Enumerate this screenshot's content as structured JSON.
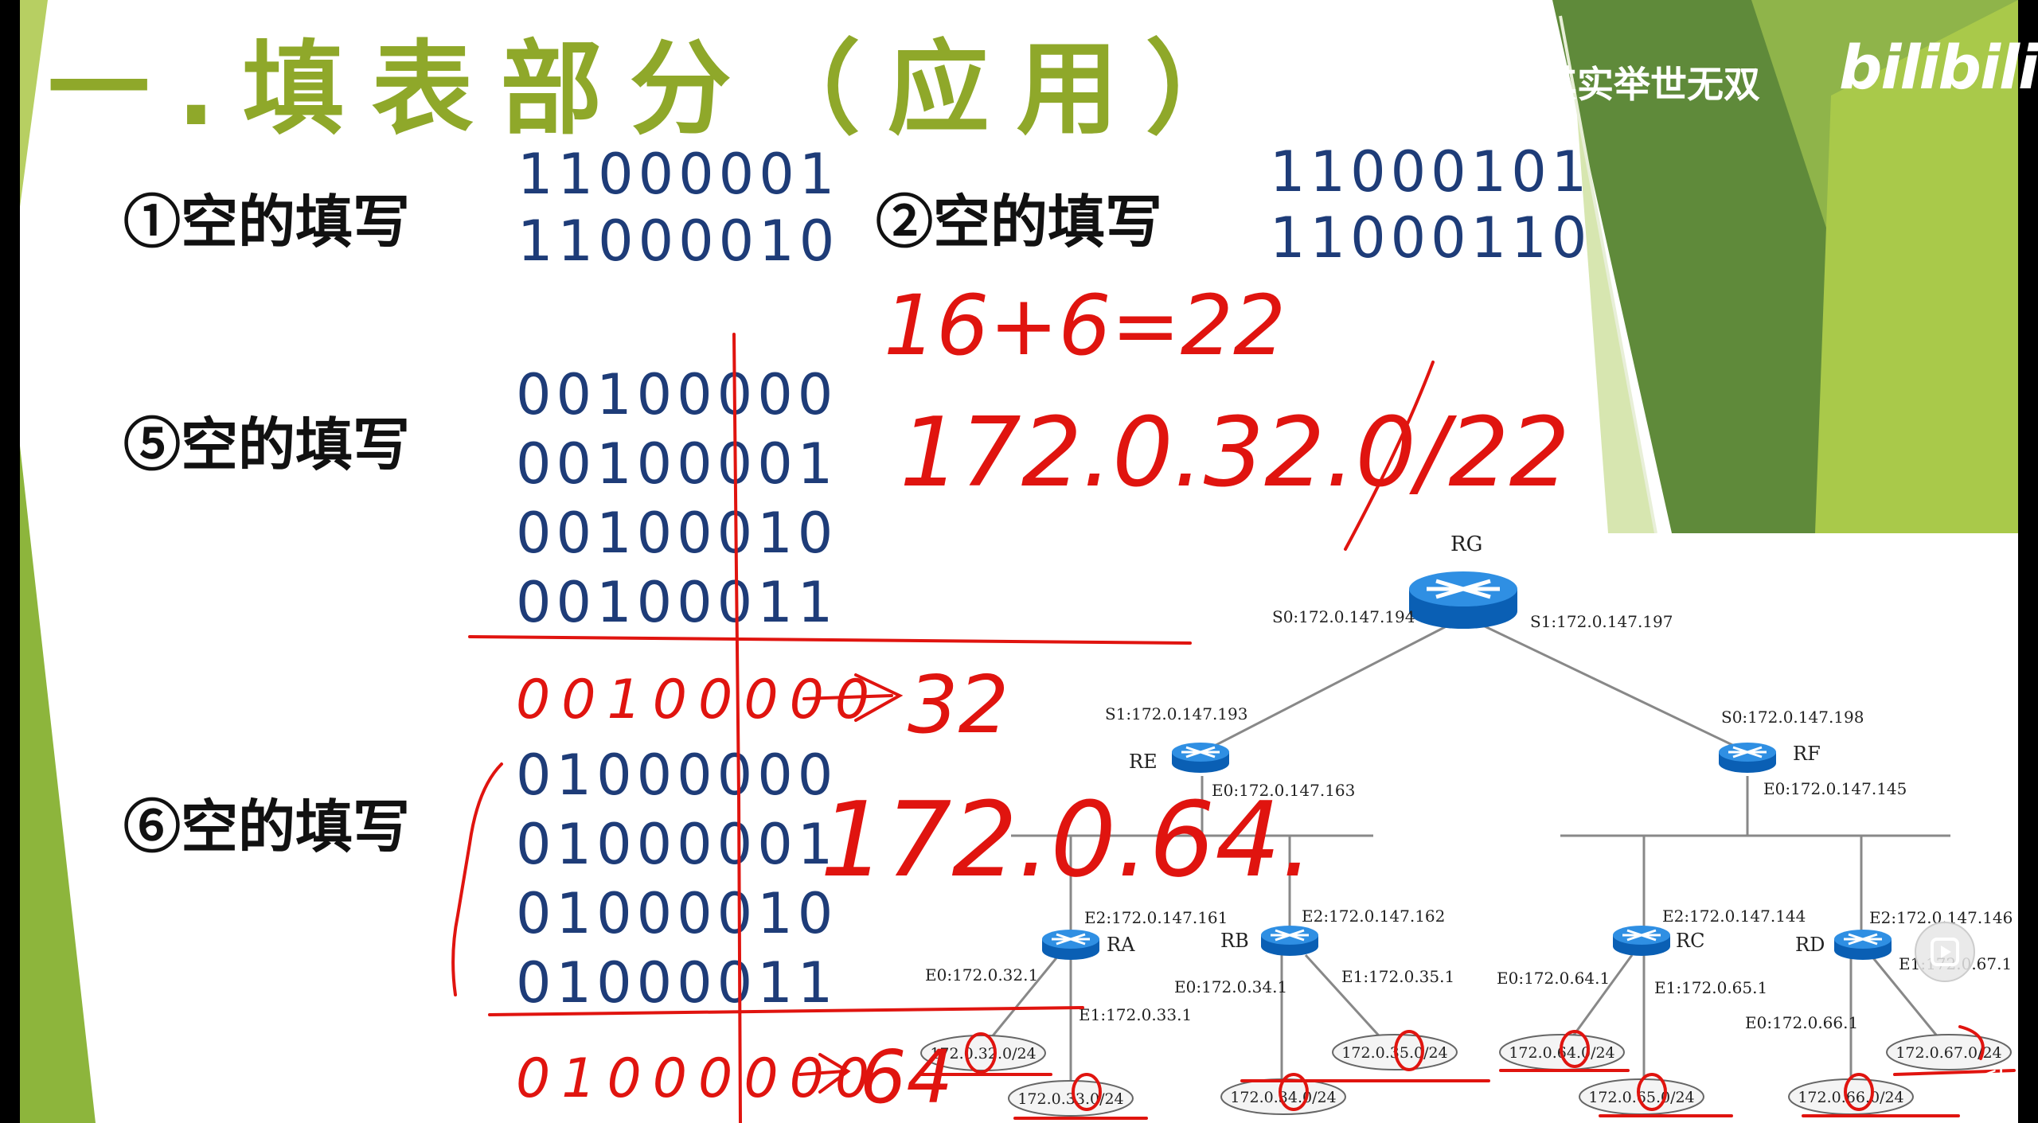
{
  "slide": {
    "title": "一.填表部分（应用）",
    "blank1": {
      "label": "①空的填写",
      "lines": [
        "11000001",
        "11000010"
      ]
    },
    "blank2": {
      "label": "②空的填写",
      "lines": [
        "11000101",
        "11000110"
      ]
    },
    "blank5": {
      "label": "⑤空的填写",
      "lines": [
        "00100000",
        "00100001",
        "00100010",
        "00100011"
      ]
    },
    "blank6": {
      "label": "⑥空的填写",
      "lines": [
        "01000000",
        "01000001",
        "01000010",
        "01000011"
      ]
    }
  },
  "handwriting": {
    "sum": "16+6=22",
    "result5": "172.0.32.0/22",
    "bits5": "00100000",
    "arrow5": "32",
    "result6": "172.0.64.",
    "bits6": "01000000",
    "arrow6": "64"
  },
  "network": {
    "routers": {
      "rg": {
        "label": "RG",
        "s0": "S0:172.0.147.194",
        "s1": "S1:172.0.147.197"
      },
      "re": {
        "label": "RE",
        "s1": "S1:172.0.147.193",
        "e0": "E0:172.0.147.163"
      },
      "rf": {
        "label": "RF",
        "s0": "S0:172.0.147.198",
        "e0": "E0:172.0.147.145"
      },
      "ra": {
        "label": "RA",
        "e2": "E2:172.0.147.161",
        "e0": "E0:172.0.32.1",
        "e1": "E1:172.0.33.1"
      },
      "rb": {
        "label": "RB",
        "e2": "E2:172.0.147.162",
        "e0": "E0:172.0.34.1",
        "e1": "E1:172.0.35.1"
      },
      "rc": {
        "label": "RC",
        "e2": "E2:172.0.147.144",
        "e0": "E0:172.0.64.1",
        "e1": "E1:172.0.65.1"
      },
      "rd": {
        "label": "RD",
        "e2": "E2:172.0.147.146",
        "e0": "E0:172.0.66.1",
        "e1": "E1:172.0.67.1"
      }
    },
    "subnets": {
      "n32": "172.0.32.0/24",
      "n33": "172.0.33.0/24",
      "n34": "172.0.34.0/24",
      "n35": "172.0.35.0/24",
      "n64": "172.0.64.0/24",
      "n65": "172.0.65.0/24",
      "n66": "172.0.66.0/24",
      "n67": "172.0.67.0/24"
    }
  },
  "overlay": {
    "watermark": "其实举世无双",
    "logo": "bilibili",
    "player_nav": "<I"
  },
  "colors": {
    "title_green": "#8fa82a",
    "binary_blue": "#1e3c78",
    "ink_red": "#e0140f",
    "deco_green_dark": "#5f8a3a",
    "deco_green_light": "#a9c94a"
  }
}
